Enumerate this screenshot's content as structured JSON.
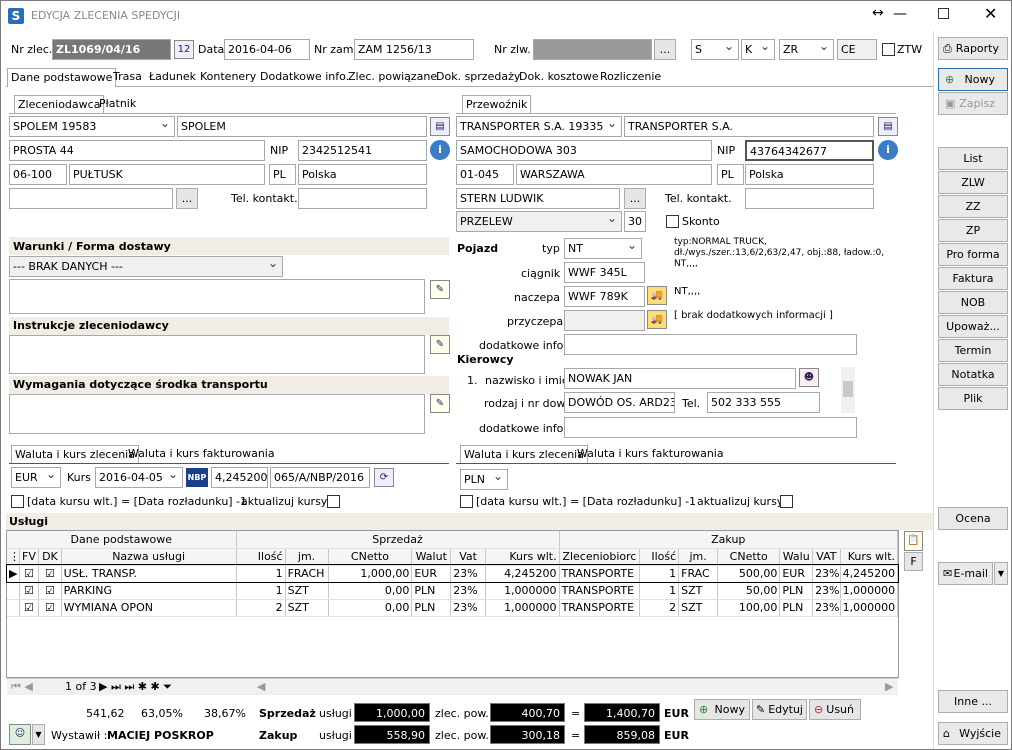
{
  "window": {
    "title": "EDYCJA ZLECENIA SPEDYCJI",
    "app_icon": "S"
  },
  "header": {
    "nr_zlec_label": "Nr zlec.",
    "nr_zlec": "ZL1069/04/16",
    "data_label": "Data",
    "data": "2016-04-06",
    "nr_zam_label": "Nr zam.",
    "nr_zam": "ZAM 1256/13",
    "nr_zlw_label": "Nr zlw.",
    "nr_zlw": "",
    "sel_s": "S",
    "sel_k": "K",
    "sel_zr": "ZR",
    "ce": "CE",
    "ztw_label": "ZTW"
  },
  "tabs": [
    "Dane podstawowe",
    "Trasa",
    "Ładunek",
    "Kontenery",
    "Dodatkowe info.",
    "Zlec. powiązane",
    "Dok. sprzedaży",
    "Dok. kosztowe",
    "Rozliczenie"
  ],
  "client_tabs": [
    "Zleceniodawca",
    "Płatnik"
  ],
  "client": {
    "code": "SPOLEM 19583",
    "name": "SPOLEM",
    "street": "PROSTA 44",
    "nip_label": "NIP",
    "nip": "2342512541",
    "zip": "06-100",
    "city": "PUŁTUSK",
    "country_code": "PL",
    "country": "Polska",
    "contact": "",
    "tel_label": "Tel. kontakt.",
    "tel": ""
  },
  "carrier_tab": "Przewoźnik",
  "carrier": {
    "code": "TRANSPORTER S.A. 19335",
    "name": "TRANSPORTER S.A.",
    "street": "SAMOCHODOWA 303",
    "nip_label": "NIP",
    "nip": "43764342677",
    "zip": "01-045",
    "city": "WARSZAWA",
    "country_code": "PL",
    "country": "Polska",
    "contact": "STERN LUDWIK",
    "tel_label": "Tel. kontakt.",
    "tel": "",
    "payment": "PRZELEW",
    "days": "30",
    "skonto_label": "Skonto"
  },
  "sections": {
    "warunki": "Warunki / Forma dostawy",
    "warunki_value": "--- BRAK DANYCH ---",
    "instrukcje": "Instrukcje zleceniodawcy",
    "wymagania": "Wymagania dotyczące środka transportu"
  },
  "vehicle": {
    "title": "Pojazd",
    "typ_label": "typ",
    "typ": "NT",
    "typ_info": "typ:NORMAL TRUCK, dł./wys./szer.:13,6/2,63/2,47, obj.:88, ładow.:0, NT,,,,",
    "ciagnik_label": "ciągnik",
    "ciagnik": "WWF 345L",
    "naczepa_label": "naczepa",
    "naczepa": "WWF 789K",
    "naczepa_info": "NT,,,,",
    "przyczepa_label": "przyczepa",
    "przyczepa": "",
    "przyczepa_info": "[ brak dodatkowych informacji ]",
    "dodatkowe_label": "dodatkowe info.",
    "dodatkowe": ""
  },
  "drivers": {
    "title": "Kierowcy",
    "index": "1.",
    "name_label": "nazwisko i imię",
    "name": "NOWAK JAN",
    "doc_label": "rodzaj i nr dow.",
    "doc": "DOWÓD OS. ARD23",
    "tel_label": "Tel.",
    "tel": "502 333 555",
    "dodatkowe_label": "dodatkowe info.",
    "dodatkowe": ""
  },
  "currency_left": {
    "tabs": [
      "Waluta i kurs zlecenia",
      "Waluta i kurs fakturowania"
    ],
    "currency": "EUR",
    "kurs_label": "Kurs",
    "date": "2016-04-05",
    "nbp": "NBP",
    "rate": "4,245200",
    "table": "065/A/NBP/2016",
    "note": "[data kursu wlt.] = [Data rozładunku] -1",
    "update_label": "aktualizuj kursy"
  },
  "currency_right": {
    "tabs": [
      "Waluta i kurs zlecenia",
      "Waluta i kurs fakturowania"
    ],
    "currency": "PLN",
    "note": "[data kursu wlt.] = [Data rozładunku] -1",
    "update_label": "aktualizuj kursy"
  },
  "services": {
    "title": "Usługi",
    "group_headers": [
      "Dane podstawowe",
      "Sprzedaż",
      "Zakup"
    ],
    "columns": [
      "FV",
      "DK",
      "Nazwa usługi",
      "Ilość",
      "jm.",
      "CNetto",
      "Walut",
      "Vat",
      "Kurs wlt.",
      "Zleceniobiorc",
      "Ilość",
      "jm.",
      "CNetto",
      "Walu",
      "VAT",
      "Kurs wlt."
    ],
    "rows": [
      [
        "USŁ. TRANSP.",
        "1",
        "FRACH",
        "1,000,00",
        "EUR",
        "23%",
        "4,245200",
        "TRANSPORTE",
        "1",
        "FRAC",
        "500,00",
        "EUR",
        "23%",
        "4,245200"
      ],
      [
        "PARKING",
        "1",
        "SZT",
        "0,00",
        "PLN",
        "23%",
        "1,000000",
        "TRANSPORTE",
        "1",
        "SZT",
        "50,00",
        "PLN",
        "23%",
        "1,000000"
      ],
      [
        "WYMIANA OPON",
        "2",
        "SZT",
        "0,00",
        "PLN",
        "23%",
        "1,000000",
        "TRANSPORTE",
        "2",
        "SZT",
        "100,00",
        "PLN",
        "23%",
        "1,000000"
      ]
    ],
    "pager": "1 of 3",
    "side_buttons": [
      "F"
    ]
  },
  "footer": {
    "stat1": "541,62",
    "stat2": "63,05%",
    "stat3": "38,67%",
    "sprzedaz_label": "Sprzedaż",
    "zakup_label": "Zakup",
    "uslugi_label": "usługi",
    "zlec_pow_label": "zlec. pow.",
    "eq": "=",
    "currency": "EUR",
    "s_uslugi": "1,000,00",
    "s_zlec": "400,70",
    "s_total": "1,400,70",
    "z_uslugi": "558,90",
    "z_zlec": "300,18",
    "z_total": "859,08",
    "wystawil_label": "Wystawił :",
    "wystawil": "MACIEJ POSKROP",
    "btn_nowy": "Nowy",
    "btn_edytuj": "Edytuj",
    "btn_usun": "Usuń"
  },
  "right_panel": {
    "raporty": "Raporty",
    "nowy": "Nowy",
    "zapisz": "Zapisz",
    "list": [
      "List",
      "ZLW",
      "ZZ",
      "ZP",
      "Pro forma",
      "Faktura",
      "NOB",
      "Upoważ...",
      "Termin",
      "Notatka",
      "Plik"
    ],
    "ocena": "Ocena",
    "email": "E-mail",
    "inne": "Inne ...",
    "wyjscie": "Wyjście"
  }
}
